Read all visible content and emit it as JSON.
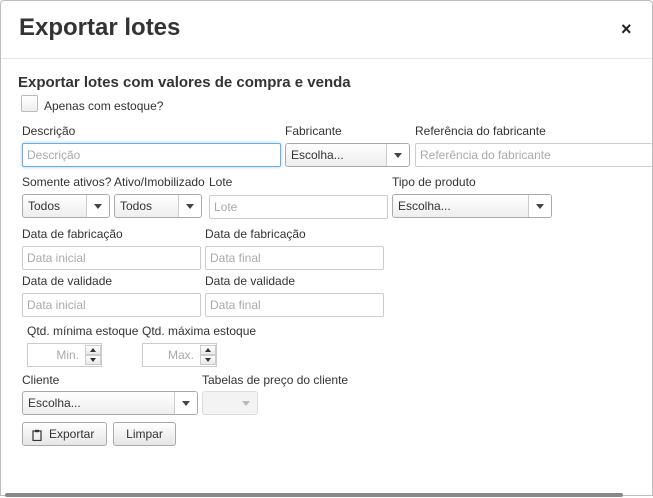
{
  "dialog": {
    "title": "Exportar lotes",
    "close_glyph": "×",
    "subtitle": "Exportar lotes com valores de compra e venda"
  },
  "stock_checkbox": {
    "label": "Apenas com estoque?",
    "checked": false
  },
  "fields": {
    "descricao": {
      "label": "Descrição",
      "placeholder": "Descrição"
    },
    "fabricante": {
      "label": "Fabricante",
      "value": "Escolha..."
    },
    "referencia": {
      "label": "Referência do fabricante",
      "placeholder": "Referência do fabricante"
    },
    "somente_ativos": {
      "label": "Somente ativos?",
      "value": "Todos"
    },
    "ativo_imobilizado": {
      "label": "Ativo/Imobilizado",
      "value": "Todos"
    },
    "lote": {
      "label": "Lote",
      "placeholder": "Lote"
    },
    "tipo_produto": {
      "label": "Tipo de produto",
      "value": "Escolha..."
    },
    "fabricacao_inicio": {
      "label": "Data de fabricação",
      "placeholder": "Data inicial"
    },
    "fabricacao_fim": {
      "label": "Data de fabricação",
      "placeholder": "Data final"
    },
    "validade_inicio": {
      "label": "Data de validade",
      "placeholder": "Data inicial"
    },
    "validade_fim": {
      "label": "Data de validade",
      "placeholder": "Data final"
    },
    "qtd_min": {
      "label": "Qtd. mínima estoque",
      "placeholder": "Min."
    },
    "qtd_max": {
      "label": "Qtd. máxima estoque",
      "placeholder": "Max."
    },
    "cliente": {
      "label": "Cliente",
      "value": "Escolha..."
    },
    "tabelas_preco": {
      "label": "Tabelas de preço do cliente",
      "value": ""
    }
  },
  "buttons": {
    "exportar": "Exportar",
    "limpar": "Limpar"
  },
  "icons": {
    "export_icon": "clipboard-icon"
  }
}
